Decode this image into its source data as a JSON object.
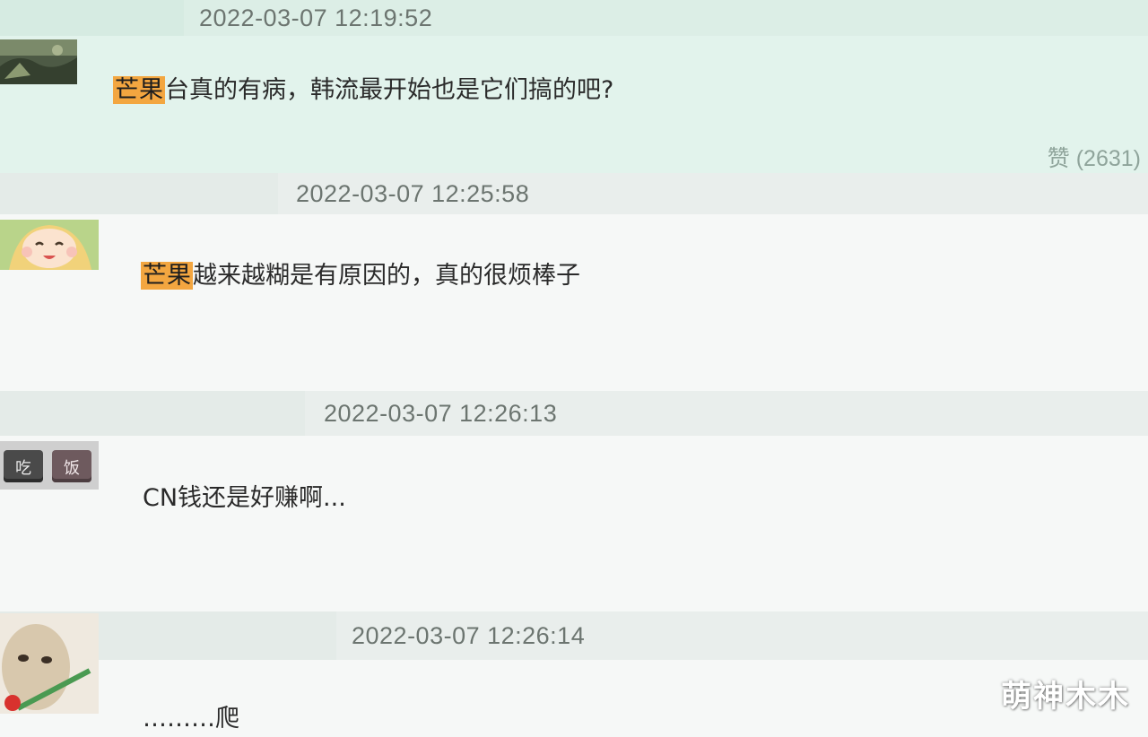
{
  "comments": [
    {
      "timestamp": "2022-03-07 12:19:52",
      "avatar_icon": "avatar-landscape-icon",
      "highlight": "芒果",
      "text": "台真的有病，韩流最开始也是它们搞的吧?",
      "likes": "赞 (2631)"
    },
    {
      "timestamp": "2022-03-07 12:25:58",
      "avatar_icon": "avatar-anime-girl-icon",
      "highlight": "芒果",
      "text": "越来越糊是有原因的，真的很烦棒子"
    },
    {
      "timestamp": "2022-03-07 12:26:13",
      "avatar_icon": "avatar-keyboard-keys-icon",
      "avatar_text": [
        "吃",
        "饭"
      ],
      "text": "CN钱还是好赚啊..."
    },
    {
      "timestamp": "2022-03-07 12:26:14",
      "avatar_icon": "avatar-cat-flower-icon",
      "text": "………爬"
    }
  ],
  "watermark": "萌神木木",
  "colors": {
    "highlighted_bg": "#e2f3ec",
    "normal_bg": "#f6f8f7",
    "timestamp_bar": "#e9eeec",
    "keyword_highlight": "#f3a640",
    "likes_text": "#8fa49b"
  }
}
